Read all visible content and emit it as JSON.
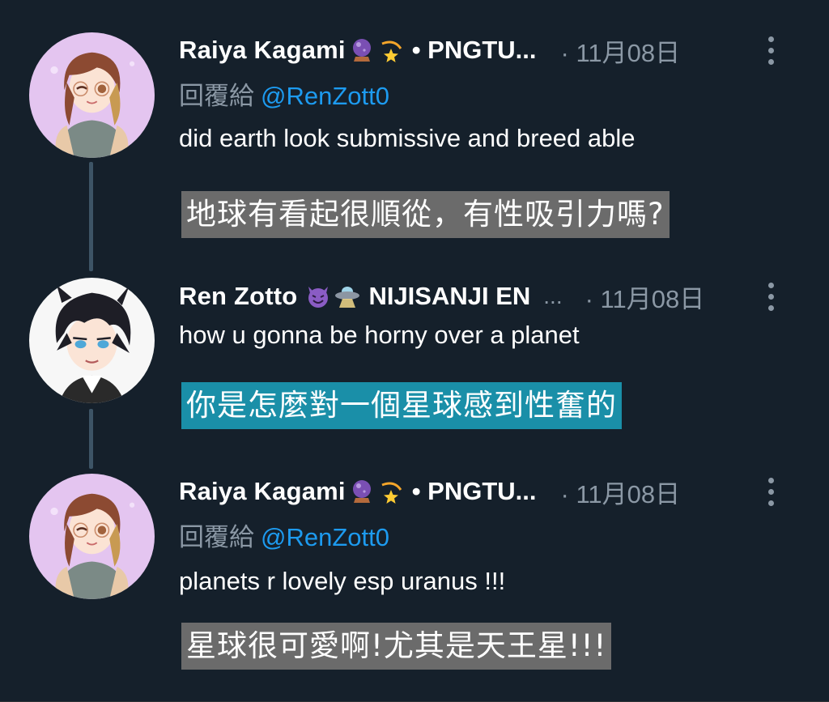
{
  "tweets": [
    {
      "author": "Raiya Kagami",
      "emojis": [
        "crystal-ball-emoji",
        "dizzy-star-emoji"
      ],
      "suffix": "• PNGTU...",
      "date": "· 11月08日",
      "reply_label": "回覆給",
      "reply_handle": "@RenZott0",
      "text": "did earth look submissive and breed able",
      "translation": "地球有看起很順從，有性吸引力嗎?"
    },
    {
      "author": "Ren Zotto",
      "emojis": [
        "smiling-devil-emoji",
        "ufo-emoji"
      ],
      "suffix": "NIJISANJI EN",
      "ellipsis": "...",
      "date": "· 11月08日",
      "text": "how u gonna be horny over a planet",
      "translation": "你是怎麼對一個星球感到性奮的"
    },
    {
      "author": "Raiya Kagami",
      "emojis": [
        "crystal-ball-emoji",
        "dizzy-star-emoji"
      ],
      "suffix": "• PNGTU...",
      "date": "· 11月08日",
      "reply_label": "回覆給",
      "reply_handle": "@RenZott0",
      "text": "planets r lovely esp uranus !!!",
      "translation": "星球很可愛啊!尤其是天王星!!!"
    }
  ],
  "colors": {
    "background": "#15202b",
    "secondary_text": "#8b98a5",
    "mention": "#1d9bf0",
    "thread_line": "#3d5466",
    "translation_gray": "#6b6b6b",
    "translation_teal": "#1a8fa8"
  }
}
